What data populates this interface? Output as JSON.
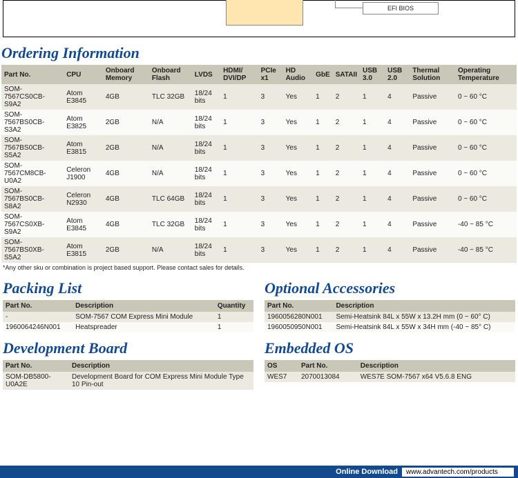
{
  "diagram": {
    "efi": "EFI BIOS"
  },
  "ordering": {
    "title": "Ordering Information",
    "headers": [
      "Part No.",
      "CPU",
      "Onboard Memory",
      "Onboard Flash",
      "LVDS",
      "HDMI/ DVI/DP",
      "PCIe x1",
      "HD Audio",
      "GbE",
      "SATAII",
      "USB 3.0",
      "USB 2.0",
      "Thermal Solution",
      "Operating Temperature"
    ],
    "rows": [
      [
        "SOM-7567CS0CB-S9A2",
        "Atom E3845",
        "4GB",
        "TLC 32GB",
        "18/24 bits",
        "1",
        "3",
        "Yes",
        "1",
        "2",
        "1",
        "4",
        "Passive",
        "0 ~ 60 °C"
      ],
      [
        "SOM-7567BS0CB-S3A2",
        "Atom E3825",
        "2GB",
        "N/A",
        "18/24 bits",
        "1",
        "3",
        "Yes",
        "1",
        "2",
        "1",
        "4",
        "Passive",
        "0 ~ 60 °C"
      ],
      [
        "SOM-7567BS0CB-S5A2",
        "Atom E3815",
        "2GB",
        "N/A",
        "18/24 bits",
        "1",
        "3",
        "Yes",
        "1",
        "2",
        "1",
        "4",
        "Passive",
        "0 ~ 60 °C"
      ],
      [
        "SOM-7567CM8CB-U0A2",
        "Celeron J1900",
        "4GB",
        "N/A",
        "18/24 bits",
        "1",
        "3",
        "Yes",
        "1",
        "2",
        "1",
        "4",
        "Passive",
        "0 ~ 60 °C"
      ],
      [
        "SOM-7567BS0CB-S8A2",
        "Celeron N2930",
        "4GB",
        "TLC 64GB",
        "18/24 bits",
        "1",
        "3",
        "Yes",
        "1",
        "2",
        "1",
        "4",
        "Passive",
        "0 ~ 60 °C"
      ],
      [
        "SOM-7567CS0XB-S9A2",
        "Atom E3845",
        "4GB",
        "TLC 32GB",
        "18/24 bits",
        "1",
        "3",
        "Yes",
        "1",
        "2",
        "1",
        "4",
        "Passive",
        "-40 ~ 85 °C"
      ],
      [
        "SOM-7567BS0XB-S5A2",
        "Atom E3815",
        "2GB",
        "N/A",
        "18/24 bits",
        "1",
        "3",
        "Yes",
        "1",
        "2",
        "1",
        "4",
        "Passive",
        "-40 ~ 85 °C"
      ]
    ],
    "note": "*Any other sku or combination is project based support. Please contact sales for details."
  },
  "packing": {
    "title": "Packing List",
    "headers": [
      "Part No.",
      "Description",
      "Quantity"
    ],
    "rows": [
      [
        "-",
        "SOM-7567 COM Express Mini Module",
        "1"
      ],
      [
        "1960064246N001",
        "Heatspreader",
        "1"
      ]
    ]
  },
  "devboard": {
    "title": "Development Board",
    "headers": [
      "Part No.",
      "Description"
    ],
    "rows": [
      [
        "SOM-DB5800-U0A2E",
        "Development Board for COM Express Mini Module Type 10 Pin-out"
      ]
    ]
  },
  "accessories": {
    "title": "Optional Accessories",
    "headers": [
      "Part No.",
      "Description"
    ],
    "rows": [
      [
        "1960056280N001",
        "Semi-Heatsink 84L x 55W x 13.2H mm (0 ~ 60° C)"
      ],
      [
        "1960050950N001",
        "Semi-Heatsink 84L x 55W x 34H mm (-40 ~ 85° C)"
      ]
    ]
  },
  "embedded": {
    "title": "Embedded OS",
    "headers": [
      "OS",
      "Part No.",
      "Description"
    ],
    "rows": [
      [
        "WES7",
        "2070013084",
        "WES7E SOM-7567 x64 V5.6.8 ENG"
      ]
    ]
  },
  "footer": {
    "label": "Online Download",
    "url": "www.advantech.com/products"
  }
}
